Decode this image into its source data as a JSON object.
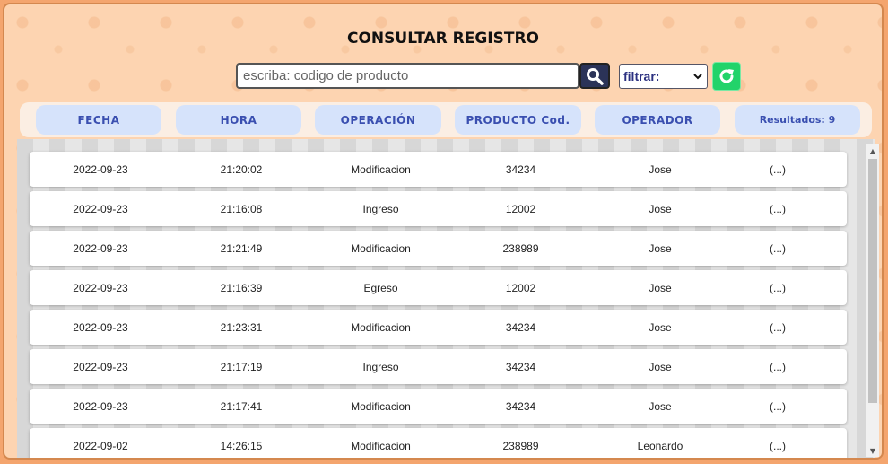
{
  "page": {
    "title": "CONSULTAR REGISTRO"
  },
  "search": {
    "placeholder": "escriba: codigo de producto",
    "value": ""
  },
  "filter": {
    "selected": "filtrar:"
  },
  "header": {
    "fecha": "FECHA",
    "hora": "HORA",
    "operacion": "OPERACIÓN",
    "producto_label": "PRODUCTO",
    "producto_suffix": "Cod.",
    "operador": "OPERADOR",
    "resultados": "Resultados: 9"
  },
  "rows": [
    {
      "fecha": "2022-09-23",
      "hora": "21:20:02",
      "operacion": "Modificacion",
      "producto": "34234",
      "operador": "Jose",
      "detalle": "(...)"
    },
    {
      "fecha": "2022-09-23",
      "hora": "21:16:08",
      "operacion": "Ingreso",
      "producto": "12002",
      "operador": "Jose",
      "detalle": "(...)"
    },
    {
      "fecha": "2022-09-23",
      "hora": "21:21:49",
      "operacion": "Modificacion",
      "producto": "238989",
      "operador": "Jose",
      "detalle": "(...)"
    },
    {
      "fecha": "2022-09-23",
      "hora": "21:16:39",
      "operacion": "Egreso",
      "producto": "12002",
      "operador": "Jose",
      "detalle": "(...)"
    },
    {
      "fecha": "2022-09-23",
      "hora": "21:23:31",
      "operacion": "Modificacion",
      "producto": "34234",
      "operador": "Jose",
      "detalle": "(...)"
    },
    {
      "fecha": "2022-09-23",
      "hora": "21:17:19",
      "operacion": "Ingreso",
      "producto": "34234",
      "operador": "Jose",
      "detalle": "(...)"
    },
    {
      "fecha": "2022-09-23",
      "hora": "21:17:41",
      "operacion": "Modificacion",
      "producto": "34234",
      "operador": "Jose",
      "detalle": "(...)"
    },
    {
      "fecha": "2022-09-02",
      "hora": "14:26:15",
      "operacion": "Modificacion",
      "producto": "238989",
      "operador": "Leonardo",
      "detalle": "(...)"
    }
  ],
  "icons": {
    "search": "search-icon",
    "refresh": "refresh-icon",
    "dropdown": "chevron-down-icon"
  },
  "colors": {
    "accent_green": "#22d36a",
    "header_cell": "#d6e3fb",
    "header_text": "#3a4fb0",
    "background": "#fdd4b1"
  }
}
